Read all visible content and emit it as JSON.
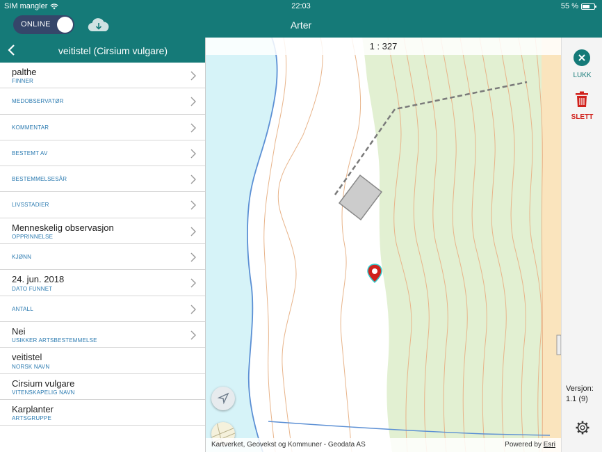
{
  "status_bar": {
    "carrier": "SIM mangler",
    "time": "22:03",
    "battery": "55 %",
    "battery_level": 0.55
  },
  "nav": {
    "mode_label": "ONLINE",
    "title": "Arter",
    "download_icon": "cloud-download-icon"
  },
  "panel": {
    "title": "veitistel (Cirsium vulgare)",
    "fields": [
      {
        "value": "palthe",
        "key": "FINNER",
        "has_chevron": true
      },
      {
        "value": "",
        "key": "MEDOBSERVATØR",
        "has_chevron": true
      },
      {
        "value": "",
        "key": "KOMMENTAR",
        "has_chevron": true
      },
      {
        "value": "",
        "key": "BESTEMT AV",
        "has_chevron": true
      },
      {
        "value": "",
        "key": "BESTEMMELSESÅR",
        "has_chevron": true
      },
      {
        "value": "",
        "key": "LIVSSTADIER",
        "has_chevron": true
      },
      {
        "value": "Menneskelig observasjon",
        "key": "OPPRINNELSE",
        "has_chevron": true
      },
      {
        "value": "",
        "key": "KJØNN",
        "has_chevron": true
      },
      {
        "value": "24. jun. 2018",
        "key": "DATO FUNNET",
        "has_chevron": true
      },
      {
        "value": "",
        "key": "ANTALL",
        "has_chevron": true
      },
      {
        "value": "Nei",
        "key": "USIKKER ARTSBESTEMMELSE",
        "has_chevron": true
      },
      {
        "value": "veitistel",
        "key": "NORSK NAVN",
        "has_chevron": false
      },
      {
        "value": "Cirsium vulgare",
        "key": "VITENSKAPELIG NAVN",
        "has_chevron": false
      },
      {
        "value": "Karplanter",
        "key": "ARTSGRUPPE",
        "has_chevron": false
      }
    ]
  },
  "map": {
    "scale": "1 : 327",
    "attribution": "Kartverket, Geovekst og Kommuner - Geodata AS",
    "powered_by": "Powered by",
    "powered_by_link": "Esri",
    "colors": {
      "water": "#d6f3f8",
      "forest": "#e2f0d2",
      "contour": "#e8b48a",
      "shore": "#5b8fd4",
      "marker": "#d0211c"
    }
  },
  "sidebar": {
    "close_label": "LUKK",
    "delete_label": "SLETT",
    "version_label": "Versjon:",
    "version_value": "1.1 (9)"
  },
  "colors": {
    "primary": "#157a78",
    "toggle": "#35466a",
    "danger": "#d0211c",
    "key_text": "#2a7ab0"
  }
}
